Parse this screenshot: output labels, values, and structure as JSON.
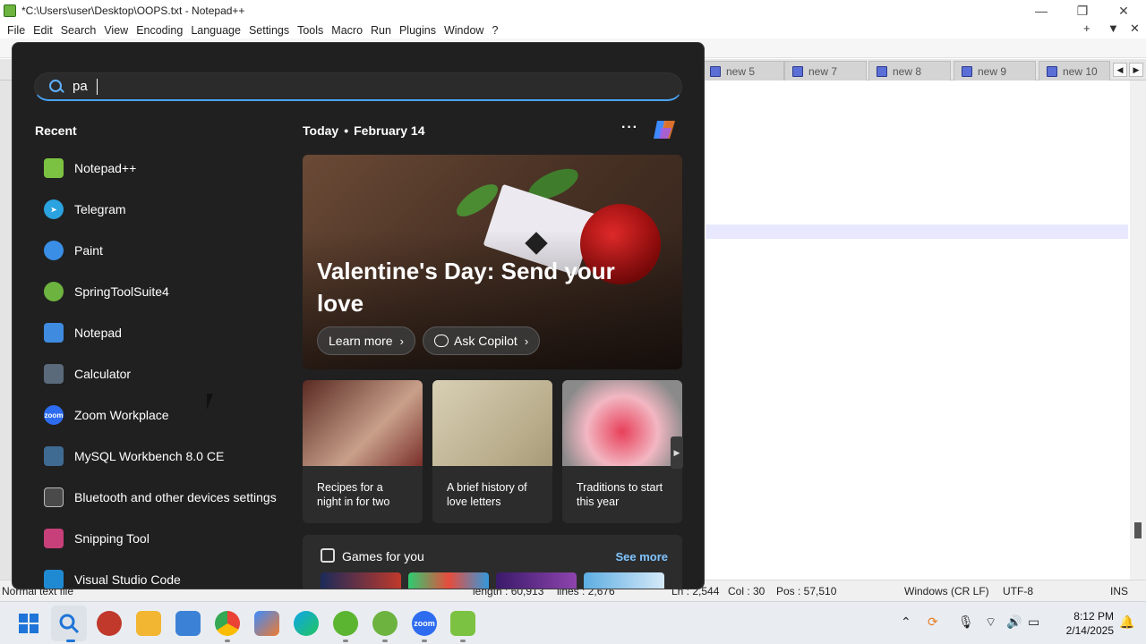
{
  "window": {
    "title": "*C:\\Users\\user\\Desktop\\OOPS.txt - Notepad++",
    "menu": [
      "File",
      "Edit",
      "Search",
      "View",
      "Encoding",
      "Language",
      "Settings",
      "Tools",
      "Macro",
      "Run",
      "Plugins",
      "Window",
      "?"
    ],
    "tabs": [
      "new 5",
      "new 7",
      "new 8",
      "new 9",
      "new 10"
    ],
    "status": {
      "file_type": "Normal text file",
      "length": "length : 60,913",
      "lines": "lines : 2,676",
      "ln": "Ln : 2,544",
      "col": "Col : 30",
      "pos": "Pos : 57,510",
      "eol": "Windows (CR LF)",
      "encoding": "UTF-8",
      "mode": "INS"
    }
  },
  "start_menu": {
    "search": {
      "value": "pa"
    },
    "recent": {
      "title": "Recent",
      "items": [
        {
          "label": "Notepad++",
          "icon": "notepadpp-icon",
          "color": "#7cc242"
        },
        {
          "label": "Telegram",
          "icon": "telegram-icon",
          "color": "#2aa3e0"
        },
        {
          "label": "Paint",
          "icon": "paint-icon",
          "color": "#3a8ee6"
        },
        {
          "label": "SpringToolSuite4",
          "icon": "spring-icon",
          "color": "#6db33f"
        },
        {
          "label": "Notepad",
          "icon": "notepad-icon",
          "color": "#3e8be0"
        },
        {
          "label": "Calculator",
          "icon": "calculator-icon",
          "color": "#5a6a7a"
        },
        {
          "label": "Zoom Workplace",
          "icon": "zoom-icon",
          "color": "#2d6cf0"
        },
        {
          "label": "MySQL Workbench 8.0 CE",
          "icon": "mysql-icon",
          "color": "#3f6b93"
        },
        {
          "label": "Bluetooth and other devices settings",
          "icon": "bluetooth-settings-icon",
          "color": "#4a4a4a"
        },
        {
          "label": "Snipping Tool",
          "icon": "snipping-tool-icon",
          "color": "#c8407a"
        },
        {
          "label": "Visual Studio Code",
          "icon": "vscode-icon",
          "color": "#1f8ad2"
        }
      ]
    },
    "today": {
      "label": "Today",
      "date": "February 14"
    },
    "hero": {
      "title": "Valentine's Day: Send your love",
      "learn_more": "Learn more",
      "ask_copilot": "Ask Copilot"
    },
    "cards": [
      {
        "text": "Recipes for a night in for two"
      },
      {
        "text": "A brief history of love letters"
      },
      {
        "text": "Traditions to start this year"
      }
    ],
    "games": {
      "title": "Games for you",
      "see_more": "See more"
    }
  },
  "taskbar": {
    "apps": [
      "start-icon",
      "search-icon",
      "app-red-icon",
      "file-explorer-icon",
      "store-icon",
      "chrome-icon",
      "copilot-icon",
      "edge-icon",
      "utorrent-icon",
      "spring-icon",
      "zoom-icon",
      "notepadpp-icon"
    ],
    "time": "8:12 PM",
    "date": "2/14/2025"
  }
}
